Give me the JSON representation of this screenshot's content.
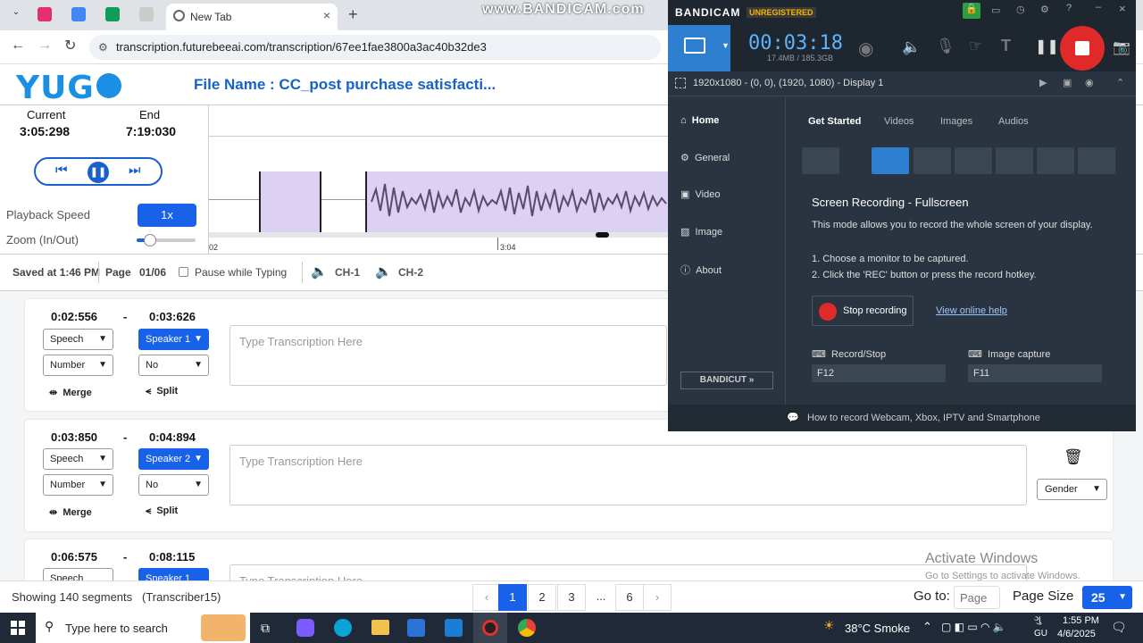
{
  "browser": {
    "tabs": [
      {
        "label": "New Tab"
      }
    ],
    "url": "transcription.futurebeeai.com/transcription/67ee1fae3800a3ac40b32de3"
  },
  "app": {
    "logo_text": "YUG",
    "file_name": "File Name : CC_post purchase satisfacti..."
  },
  "playback": {
    "current_label": "Current",
    "current_value": "3:05:298",
    "end_label": "End",
    "end_value": "7:19:030",
    "speed_label": "Playback Speed",
    "speed_value": "1x",
    "zoom_label": "Zoom (In/Out)",
    "zoom_level": 0.22
  },
  "waveform": {
    "tick_left": "02",
    "tick_mid": "3:04"
  },
  "toolbar": {
    "saved": "Saved at 1:46 PM",
    "page_label": "Page",
    "page_value": "01/06",
    "pause_label": "Pause while Typing",
    "ch1": "CH-1",
    "ch2": "CH-2"
  },
  "segments": [
    {
      "start": "0:02:556",
      "dash": "-",
      "end": "0:03:626",
      "type": "Speech",
      "speaker": "Speaker 1",
      "number": "Number",
      "no": "No",
      "placeholder": "Type Transcription Here",
      "merge": "Merge",
      "split": "Split"
    },
    {
      "start": "0:03:850",
      "dash": "-",
      "end": "0:04:894",
      "type": "Speech",
      "speaker": "Speaker 2",
      "number": "Number",
      "no": "No",
      "placeholder": "Type Transcription Here",
      "merge": "Merge",
      "split": "Split",
      "gender": "Gender"
    },
    {
      "start": "0:06:575",
      "dash": "-",
      "end": "0:08:115",
      "type": "Speech",
      "speaker": "Speaker 1",
      "placeholder": "Type Transcription Here"
    }
  ],
  "footer": {
    "showing": "Showing 140 segments",
    "transcriber": "(Transcriber15)",
    "pages": [
      "1",
      "2",
      "3",
      "...",
      "6"
    ],
    "goto_label": "Go to:",
    "goto_placeholder": "Page",
    "page_size_label": "Page Size",
    "page_size_value": "25"
  },
  "bandicam": {
    "watermark": "www.BANDICAM.com",
    "brand": "BANDICAM",
    "unregistered": "UNREGISTERED",
    "timer": "00:03:18",
    "size": "17.4MB / 185.3GB",
    "display": "1920x1080 - (0, 0), (1920, 1080) - Display 1",
    "nav": [
      "Home",
      "General",
      "Video",
      "Image",
      "About"
    ],
    "tabs": [
      "Get Started",
      "Videos",
      "Images",
      "Audios"
    ],
    "mode_title": "Screen Recording - Fullscreen",
    "mode_desc": "This mode allows you to record the whole screen of your display.",
    "step1": "1. Choose a monitor to be captured.",
    "step2": "2. Click the 'REC' button or press the record hotkey.",
    "stop_btn": "Stop recording",
    "help_link": "View online help",
    "record_stop_label": "Record/Stop",
    "record_stop_key": "F12",
    "image_capture_label": "Image capture",
    "image_capture_key": "F11",
    "bandicut": "BANDICUT",
    "footer": "How to record Webcam, Xbox, IPTV and Smartphone"
  },
  "windows": {
    "activate_title": "Activate Windows",
    "activate_sub": "Go to Settings to activate Windows.",
    "search": "Type here to search",
    "weather": "38°C  Smoke",
    "time": "1:55 PM",
    "date": "4/6/2025",
    "lang1": "ગુ",
    "lang2": "GU"
  }
}
